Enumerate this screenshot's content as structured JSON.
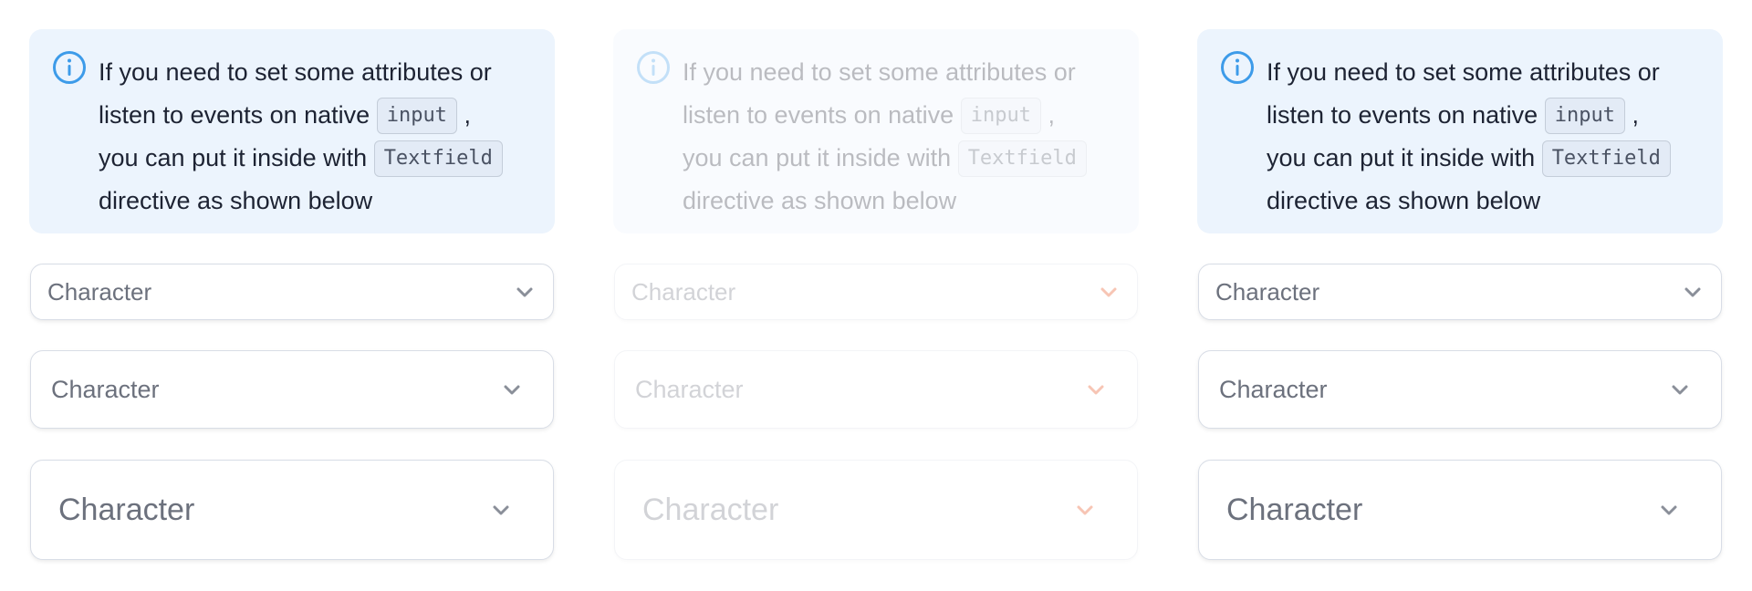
{
  "colors": {
    "info_background": "#ecf4fd",
    "info_icon": "#3d9be9",
    "chevron_default": "#8a8f99",
    "chevron_error": "#e8410c"
  },
  "columns": [
    {
      "state": "default",
      "info": {
        "line1": "If you need to set some attributes or",
        "line2_text": "listen to events on native",
        "code1": "input",
        "line2_suffix": ",",
        "line3_text": "you can put it inside with",
        "code2": "Textfield",
        "line4": "directive as shown below",
        "icon": "info-circle-icon"
      },
      "selects": [
        {
          "size": "small",
          "label": "Character",
          "icon": "chevron-down-icon"
        },
        {
          "size": "medium",
          "label": "Character",
          "icon": "chevron-down-icon"
        },
        {
          "size": "large",
          "label": "Character",
          "icon": "chevron-down-icon"
        }
      ]
    },
    {
      "state": "disabled-error",
      "info": {
        "line1": "If you need to set some attributes or",
        "line2_text": "listen to events on native",
        "code1": "input",
        "line2_suffix": ",",
        "line3_text": "you can put it inside with",
        "code2": "Textfield",
        "line4": "directive as shown below",
        "icon": "info-circle-icon"
      },
      "selects": [
        {
          "size": "small",
          "label": "Character",
          "icon": "chevron-down-icon"
        },
        {
          "size": "medium",
          "label": "Character",
          "icon": "chevron-down-icon"
        },
        {
          "size": "large",
          "label": "Character",
          "icon": "chevron-down-icon"
        }
      ]
    },
    {
      "state": "default",
      "info": {
        "line1": "If you need to set some attributes or",
        "line2_text": "listen to events on native",
        "code1": "input",
        "line2_suffix": ",",
        "line3_text": "you can put it inside with",
        "code2": "Textfield",
        "line4": "directive as shown below",
        "icon": "info-circle-icon"
      },
      "selects": [
        {
          "size": "small",
          "label": "Character",
          "icon": "chevron-down-icon"
        },
        {
          "size": "medium",
          "label": "Character",
          "icon": "chevron-down-icon"
        },
        {
          "size": "large",
          "label": "Character",
          "icon": "chevron-down-icon"
        }
      ]
    }
  ]
}
